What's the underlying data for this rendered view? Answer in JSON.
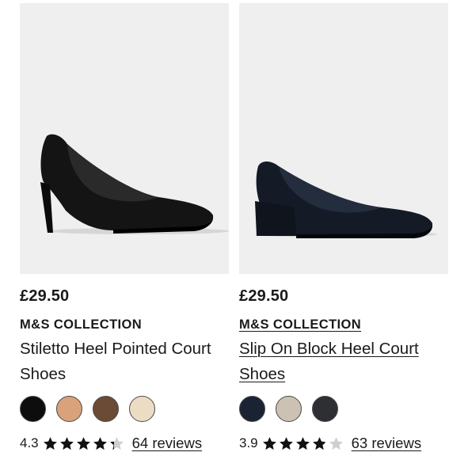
{
  "products": [
    {
      "price": "£29.50",
      "brand": "M&S COLLECTION",
      "title": "Stiletto Heel Pointed Court Shoes",
      "image_desc": "black-stiletto-court-shoe",
      "swatches": [
        {
          "name": "black",
          "color": "#0d0d0d"
        },
        {
          "name": "nude",
          "color": "#d9a27a"
        },
        {
          "name": "brown",
          "color": "#6b4a36"
        },
        {
          "name": "cream",
          "color": "#ecdcc3"
        }
      ],
      "rating": "4.3",
      "rating_value": 4.3,
      "reviews": "64 reviews"
    },
    {
      "price": "£29.50",
      "brand": "M&S COLLECTION",
      "title": "Slip On Block Heel Court Shoes",
      "image_desc": "navy-block-heel-court-shoe",
      "swatches": [
        {
          "name": "navy",
          "color": "#1a2333"
        },
        {
          "name": "taupe",
          "color": "#ccc2b4"
        },
        {
          "name": "charcoal",
          "color": "#2e2f33"
        }
      ],
      "rating": "3.9",
      "rating_value": 3.9,
      "reviews": "63 reviews"
    }
  ],
  "colors": {
    "star_filled": "#111111",
    "star_empty": "#cfcfcf",
    "tile_bg": "#efefef"
  }
}
